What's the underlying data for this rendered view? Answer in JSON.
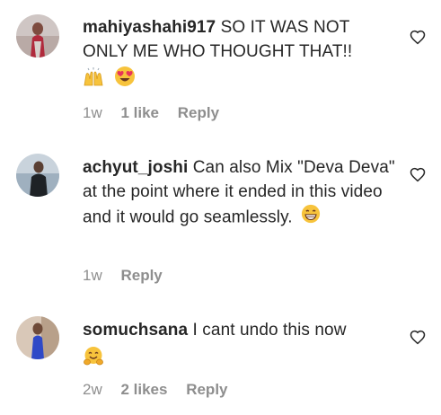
{
  "comments": [
    {
      "username": "mahiyashahi917",
      "text": "SO IT WAS NOT ONLY ME WHO THOUGHT THAT!!",
      "emojis": [
        "raising-hands",
        "heart-eyes"
      ],
      "time": "1w",
      "likes": "1 like",
      "reply": "Reply"
    },
    {
      "username": "achyut_joshi",
      "text": "Can also Mix \"Deva Deva\" at the point where it ended in this video and it would go seamlessly.",
      "emojis": [
        "grinning-face"
      ],
      "time": "1w",
      "likes": "",
      "reply": "Reply"
    },
    {
      "username": "somuchsana",
      "text": "I cant undo this now",
      "emojis": [
        "hugging-face"
      ],
      "time": "2w",
      "likes": "2 likes",
      "reply": "Reply"
    }
  ],
  "icons": {
    "like": "heart-outline-icon"
  },
  "colors": {
    "text": "#262626",
    "secondary": "#8e8e8e",
    "emoji_yellow": "#f7c33c",
    "emoji_pink": "#e8345a"
  }
}
